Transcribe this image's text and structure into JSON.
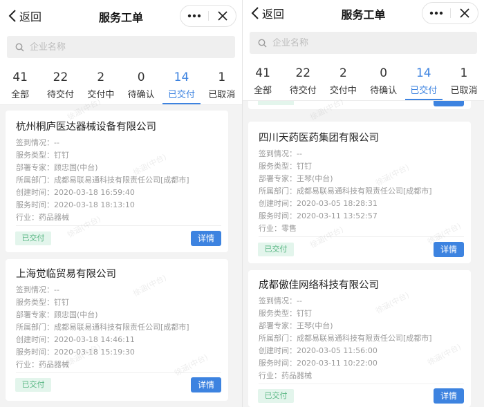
{
  "panels": [
    {
      "header": {
        "back_label": "返回",
        "title": "服务工单"
      },
      "search": {
        "placeholder": "企业名称"
      },
      "tabs": [
        {
          "count": "41",
          "label": "全部"
        },
        {
          "count": "22",
          "label": "待交付"
        },
        {
          "count": "2",
          "label": "交付中"
        },
        {
          "count": "0",
          "label": "待确认"
        },
        {
          "count": "14",
          "label": "已交付",
          "active": true
        },
        {
          "count": "1",
          "label": "已取消"
        }
      ],
      "cards": [
        {
          "name": "杭州桐庐医达器械设备有限公司",
          "lines": [
            "签到情况：--",
            "服务类型：钉钉",
            "部署专家：顾忠国(中台)",
            "所属部门：成都易联易通科技有限责任公司[成都市]",
            "创建时间：2020-03-18 16:59:40",
            "服务时间：2020-03-18 18:13:10",
            "行业：药品器械"
          ],
          "status": "已交付",
          "detail_label": "详情"
        },
        {
          "name": "上海觉临贸易有限公司",
          "lines": [
            "签到情况：--",
            "服务类型：钉钉",
            "部署专家：顾忠国(中台)",
            "所属部门：成都易联易通科技有限责任公司[成都市]",
            "创建时间：2020-03-18 14:46:11",
            "服务时间：2020-03-18 15:19:30",
            "行业：药品器械"
          ],
          "status": "已交付",
          "detail_label": "详情"
        }
      ],
      "watermark": "徐涵(中台)"
    },
    {
      "header": {
        "back_label": "返回",
        "title": "服务工单"
      },
      "search": {
        "placeholder": "企业名称"
      },
      "tabs": [
        {
          "count": "41",
          "label": "全部"
        },
        {
          "count": "22",
          "label": "待交付"
        },
        {
          "count": "2",
          "label": "交付中"
        },
        {
          "count": "0",
          "label": "待确认"
        },
        {
          "count": "14",
          "label": "已交付",
          "active": true
        },
        {
          "count": "1",
          "label": "已取消"
        }
      ],
      "cards": [
        {
          "name": "四川天药医药集团有限公司",
          "lines": [
            "签到情况：--",
            "服务类型：钉钉",
            "部署专家：王琴(中台)",
            "所属部门：成都易联易通科技有限责任公司[成都市]",
            "创建时间：2020-03-05 18:28:31",
            "服务时间：2020-03-11 13:52:57",
            "行业：零售"
          ],
          "status": "已交付",
          "detail_label": "详情"
        },
        {
          "name": "成都傲佳网络科技有限公司",
          "lines": [
            "签到情况：--",
            "服务类型：钉钉",
            "部署专家：王琴(中台)",
            "所属部门：成都易联易通科技有限责任公司[成都市]",
            "创建时间：2020-03-05 11:56:00",
            "服务时间：2020-03-11 10:22:00",
            "行业：药品器械"
          ],
          "status": "已交付",
          "detail_label": "详情"
        }
      ],
      "watermark": "徐涵(中台)"
    }
  ],
  "colors": {
    "accent": "#3d83e0",
    "status_bg": "#e3f5ec",
    "status_text": "#57b682"
  }
}
